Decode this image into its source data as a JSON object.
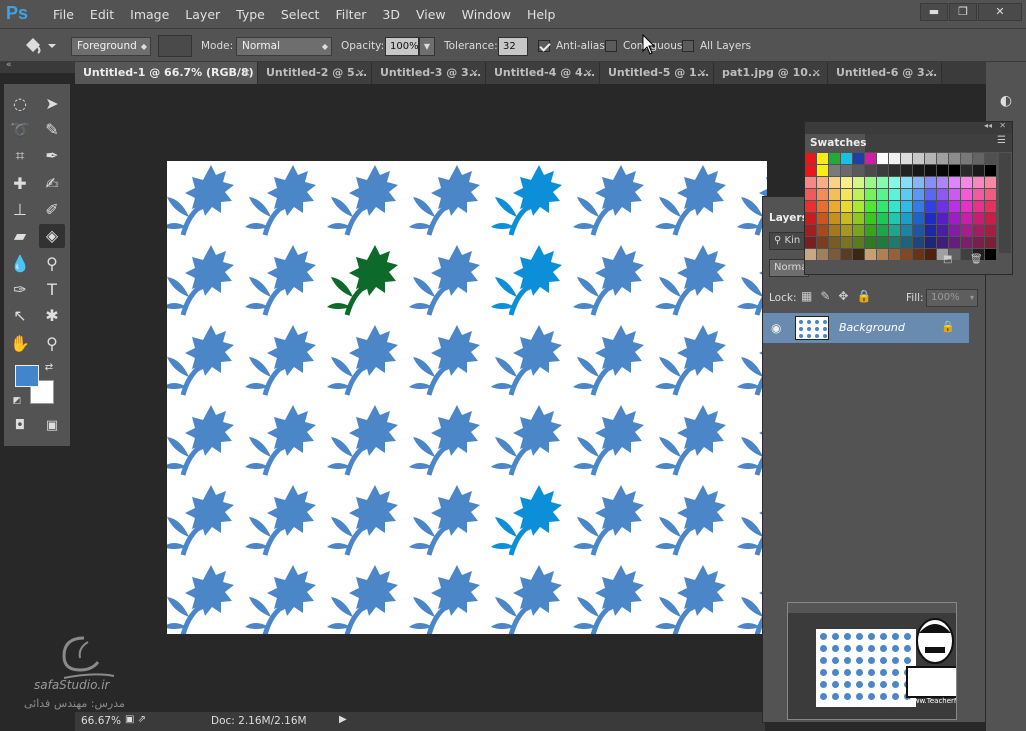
{
  "app": {
    "logo": "Ps"
  },
  "menubar": {
    "items": [
      "File",
      "Edit",
      "Image",
      "Layer",
      "Type",
      "Select",
      "Filter",
      "3D",
      "View",
      "Window",
      "Help"
    ]
  },
  "window_controls": {
    "minimize": "▬",
    "restore": "❐",
    "close": "✕"
  },
  "options": {
    "fill_source": "Foreground",
    "mode_label": "Mode:",
    "mode_value": "Normal",
    "opacity_label": "Opacity:",
    "opacity_value": "100%",
    "tolerance_label": "Tolerance:",
    "tolerance_value": "32",
    "antialias_label": "Anti-alias",
    "antialias_checked": true,
    "contiguous_label": "Contiguous",
    "contiguous_checked": false,
    "alllayers_label": "All Layers",
    "alllayers_checked": false
  },
  "tabs": [
    {
      "label": "Untitled-1 @ 66.7% (RGB/8) *",
      "active": true
    },
    {
      "label": "Untitled-2 @ 5...",
      "active": false
    },
    {
      "label": "Untitled-3 @ 3...",
      "active": false
    },
    {
      "label": "Untitled-4 @ 4...",
      "active": false
    },
    {
      "label": "Untitled-5 @ 1...",
      "active": false
    },
    {
      "label": "pat1.jpg @ 10...",
      "active": false
    },
    {
      "label": "Untitled-6 @ 3...",
      "active": false
    }
  ],
  "colors": {
    "foreground": "#4385cc",
    "background": "#ffffff",
    "flower": "#4a86c8",
    "flower_highlight": "#0b8fd8",
    "flower_green": "#0d6a2a"
  },
  "swatches": {
    "title": "Swatches"
  },
  "layers": {
    "title": "Layers",
    "kind_label": "Kin",
    "blend": "Norma",
    "lock_label": "Lock:",
    "fill_label": "Fill:",
    "fill_value": "100%",
    "layer_name": "Background"
  },
  "status": {
    "zoom": "66.67%",
    "doc": "Doc: 2.16M/2.16M"
  },
  "watermark": {
    "brand": "safaStudio.ir",
    "sub": "مدرس: مهندس فدائی"
  },
  "thumbnail": {
    "credit": "www.TeacherMan.ir"
  }
}
